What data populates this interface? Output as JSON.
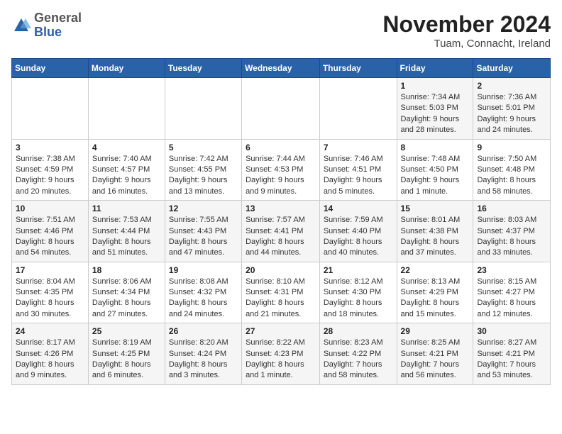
{
  "logo": {
    "general": "General",
    "blue": "Blue"
  },
  "header": {
    "month_title": "November 2024",
    "subtitle": "Tuam, Connacht, Ireland"
  },
  "weekdays": [
    "Sunday",
    "Monday",
    "Tuesday",
    "Wednesday",
    "Thursday",
    "Friday",
    "Saturday"
  ],
  "weeks": [
    [
      null,
      null,
      null,
      null,
      null,
      {
        "day": "1",
        "sunrise": "Sunrise: 7:34 AM",
        "sunset": "Sunset: 5:03 PM",
        "daylight": "Daylight: 9 hours and 28 minutes."
      },
      {
        "day": "2",
        "sunrise": "Sunrise: 7:36 AM",
        "sunset": "Sunset: 5:01 PM",
        "daylight": "Daylight: 9 hours and 24 minutes."
      }
    ],
    [
      {
        "day": "3",
        "sunrise": "Sunrise: 7:38 AM",
        "sunset": "Sunset: 4:59 PM",
        "daylight": "Daylight: 9 hours and 20 minutes."
      },
      {
        "day": "4",
        "sunrise": "Sunrise: 7:40 AM",
        "sunset": "Sunset: 4:57 PM",
        "daylight": "Daylight: 9 hours and 16 minutes."
      },
      {
        "day": "5",
        "sunrise": "Sunrise: 7:42 AM",
        "sunset": "Sunset: 4:55 PM",
        "daylight": "Daylight: 9 hours and 13 minutes."
      },
      {
        "day": "6",
        "sunrise": "Sunrise: 7:44 AM",
        "sunset": "Sunset: 4:53 PM",
        "daylight": "Daylight: 9 hours and 9 minutes."
      },
      {
        "day": "7",
        "sunrise": "Sunrise: 7:46 AM",
        "sunset": "Sunset: 4:51 PM",
        "daylight": "Daylight: 9 hours and 5 minutes."
      },
      {
        "day": "8",
        "sunrise": "Sunrise: 7:48 AM",
        "sunset": "Sunset: 4:50 PM",
        "daylight": "Daylight: 9 hours and 1 minute."
      },
      {
        "day": "9",
        "sunrise": "Sunrise: 7:50 AM",
        "sunset": "Sunset: 4:48 PM",
        "daylight": "Daylight: 8 hours and 58 minutes."
      }
    ],
    [
      {
        "day": "10",
        "sunrise": "Sunrise: 7:51 AM",
        "sunset": "Sunset: 4:46 PM",
        "daylight": "Daylight: 8 hours and 54 minutes."
      },
      {
        "day": "11",
        "sunrise": "Sunrise: 7:53 AM",
        "sunset": "Sunset: 4:44 PM",
        "daylight": "Daylight: 8 hours and 51 minutes."
      },
      {
        "day": "12",
        "sunrise": "Sunrise: 7:55 AM",
        "sunset": "Sunset: 4:43 PM",
        "daylight": "Daylight: 8 hours and 47 minutes."
      },
      {
        "day": "13",
        "sunrise": "Sunrise: 7:57 AM",
        "sunset": "Sunset: 4:41 PM",
        "daylight": "Daylight: 8 hours and 44 minutes."
      },
      {
        "day": "14",
        "sunrise": "Sunrise: 7:59 AM",
        "sunset": "Sunset: 4:40 PM",
        "daylight": "Daylight: 8 hours and 40 minutes."
      },
      {
        "day": "15",
        "sunrise": "Sunrise: 8:01 AM",
        "sunset": "Sunset: 4:38 PM",
        "daylight": "Daylight: 8 hours and 37 minutes."
      },
      {
        "day": "16",
        "sunrise": "Sunrise: 8:03 AM",
        "sunset": "Sunset: 4:37 PM",
        "daylight": "Daylight: 8 hours and 33 minutes."
      }
    ],
    [
      {
        "day": "17",
        "sunrise": "Sunrise: 8:04 AM",
        "sunset": "Sunset: 4:35 PM",
        "daylight": "Daylight: 8 hours and 30 minutes."
      },
      {
        "day": "18",
        "sunrise": "Sunrise: 8:06 AM",
        "sunset": "Sunset: 4:34 PM",
        "daylight": "Daylight: 8 hours and 27 minutes."
      },
      {
        "day": "19",
        "sunrise": "Sunrise: 8:08 AM",
        "sunset": "Sunset: 4:32 PM",
        "daylight": "Daylight: 8 hours and 24 minutes."
      },
      {
        "day": "20",
        "sunrise": "Sunrise: 8:10 AM",
        "sunset": "Sunset: 4:31 PM",
        "daylight": "Daylight: 8 hours and 21 minutes."
      },
      {
        "day": "21",
        "sunrise": "Sunrise: 8:12 AM",
        "sunset": "Sunset: 4:30 PM",
        "daylight": "Daylight: 8 hours and 18 minutes."
      },
      {
        "day": "22",
        "sunrise": "Sunrise: 8:13 AM",
        "sunset": "Sunset: 4:29 PM",
        "daylight": "Daylight: 8 hours and 15 minutes."
      },
      {
        "day": "23",
        "sunrise": "Sunrise: 8:15 AM",
        "sunset": "Sunset: 4:27 PM",
        "daylight": "Daylight: 8 hours and 12 minutes."
      }
    ],
    [
      {
        "day": "24",
        "sunrise": "Sunrise: 8:17 AM",
        "sunset": "Sunset: 4:26 PM",
        "daylight": "Daylight: 8 hours and 9 minutes."
      },
      {
        "day": "25",
        "sunrise": "Sunrise: 8:19 AM",
        "sunset": "Sunset: 4:25 PM",
        "daylight": "Daylight: 8 hours and 6 minutes."
      },
      {
        "day": "26",
        "sunrise": "Sunrise: 8:20 AM",
        "sunset": "Sunset: 4:24 PM",
        "daylight": "Daylight: 8 hours and 3 minutes."
      },
      {
        "day": "27",
        "sunrise": "Sunrise: 8:22 AM",
        "sunset": "Sunset: 4:23 PM",
        "daylight": "Daylight: 8 hours and 1 minute."
      },
      {
        "day": "28",
        "sunrise": "Sunrise: 8:23 AM",
        "sunset": "Sunset: 4:22 PM",
        "daylight": "Daylight: 7 hours and 58 minutes."
      },
      {
        "day": "29",
        "sunrise": "Sunrise: 8:25 AM",
        "sunset": "Sunset: 4:21 PM",
        "daylight": "Daylight: 7 hours and 56 minutes."
      },
      {
        "day": "30",
        "sunrise": "Sunrise: 8:27 AM",
        "sunset": "Sunset: 4:21 PM",
        "daylight": "Daylight: 7 hours and 53 minutes."
      }
    ]
  ]
}
